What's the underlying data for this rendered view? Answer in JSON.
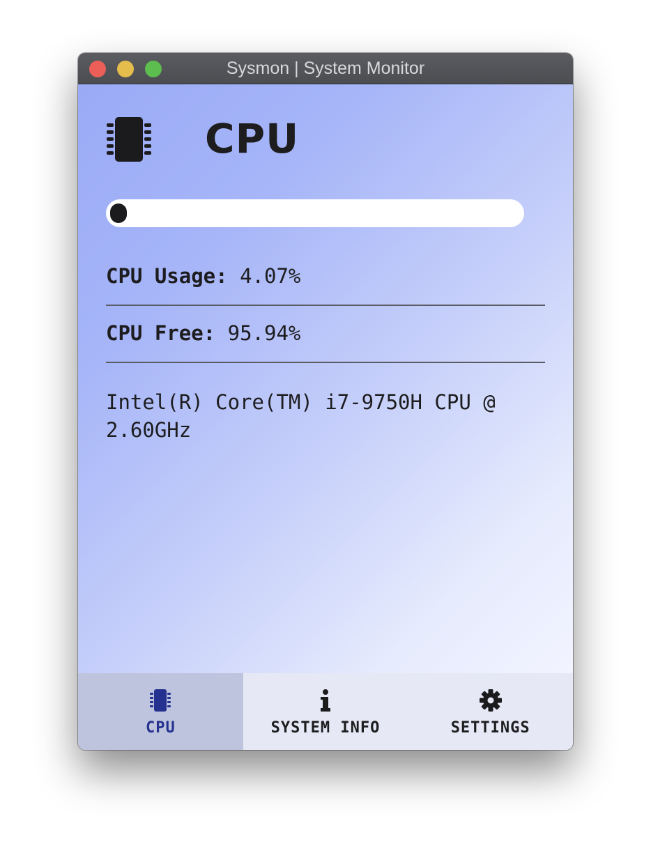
{
  "window": {
    "title": "Sysmon | System Monitor"
  },
  "cpu": {
    "heading": "CPU",
    "icon": "cpu-chip-icon",
    "usage_fraction": 0.0407,
    "usage_label": "CPU Usage:",
    "usage_value": "4.07%",
    "free_label": "CPU Free:",
    "free_value": "95.94%",
    "model": "Intel(R) Core(TM) i7-9750H CPU @ 2.60GHz"
  },
  "nav": {
    "items": [
      {
        "label": "CPU",
        "icon": "cpu-chip-icon",
        "active": true
      },
      {
        "label": "SYSTEM INFO",
        "icon": "info-icon",
        "active": false
      },
      {
        "label": "SETTINGS",
        "icon": "gear-icon",
        "active": false
      }
    ]
  },
  "colors": {
    "active_tab_text": "#24318f",
    "progress_fill": "#1b1b1d",
    "close": "#ec5f59",
    "minimize": "#e4bd4d",
    "maximize": "#5dbd4e"
  }
}
